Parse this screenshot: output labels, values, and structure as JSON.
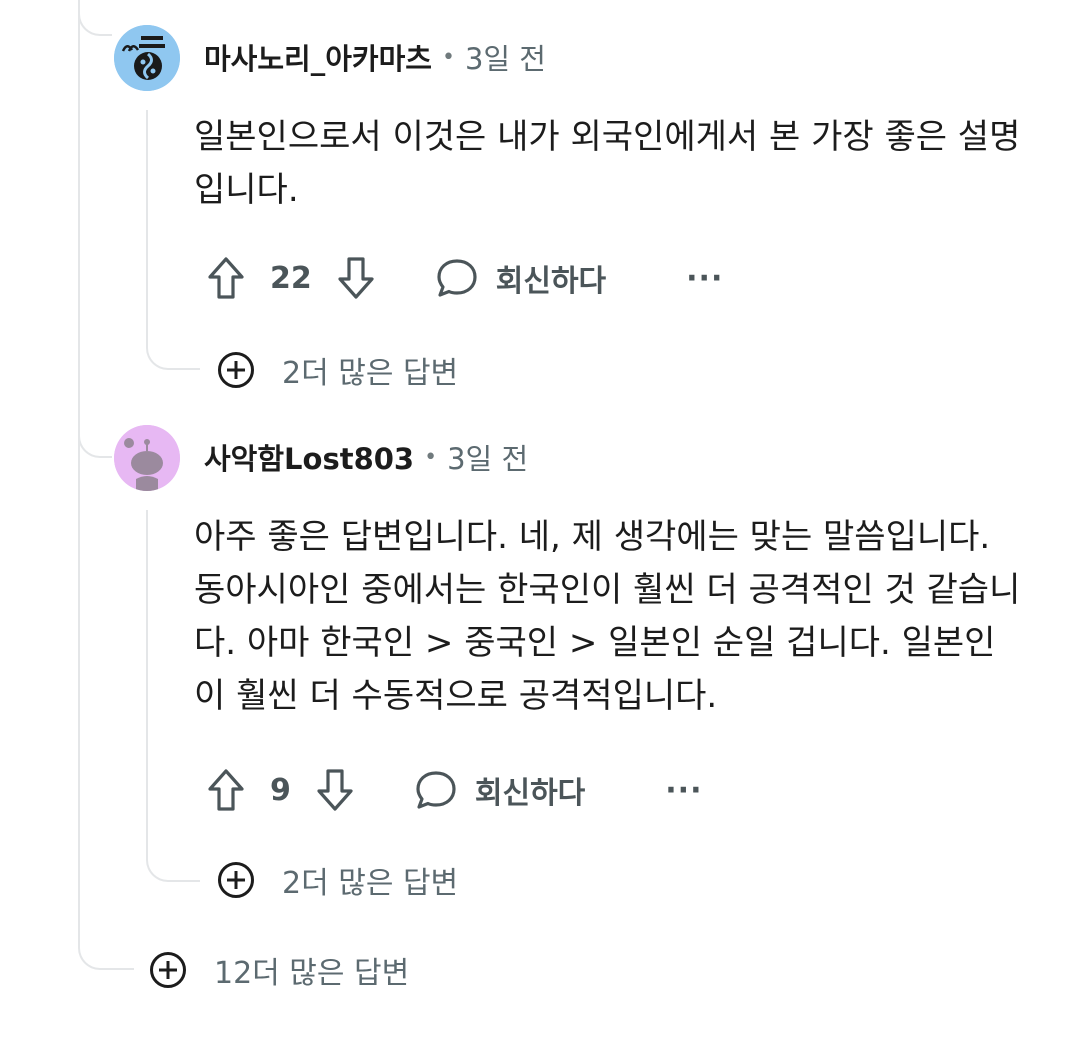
{
  "comments": [
    {
      "username": "마사노리_아카마츠",
      "separator": "•",
      "time": "3일 전",
      "avatar_color": "#8fc7f0",
      "text": "일본인으로서 이것은 내가 외국인에게서 본 가장 좋은 설명입니다.",
      "votes": "22",
      "reply_label": "회신하다",
      "more_label": "···",
      "more_replies": "2더 많은 답변"
    },
    {
      "username": "사악함Lost803",
      "separator": "•",
      "time": "3일 전",
      "avatar_color": "#e7b8f3",
      "text": "아주 좋은 답변입니다. 네, 제 생각에는 맞는 말씀입니다. 동아시아인 중에서는 한국인이 훨씬 더 공격적인 것 같습니다. 아마 한국인 > 중국인 > 일본인 순일 겁니다. 일본인이 훨씬 더 수동적으로 공격적입니다.",
      "votes": "9",
      "reply_label": "회신하다",
      "more_label": "···",
      "more_replies": "2더 많은 답변"
    }
  ],
  "thread_more_replies": "12더 많은 답변",
  "colors": {
    "thread_line": "#e4e6e8",
    "text": "#1c1c1c",
    "muted": "#5c6a70",
    "action": "#4b5559"
  }
}
